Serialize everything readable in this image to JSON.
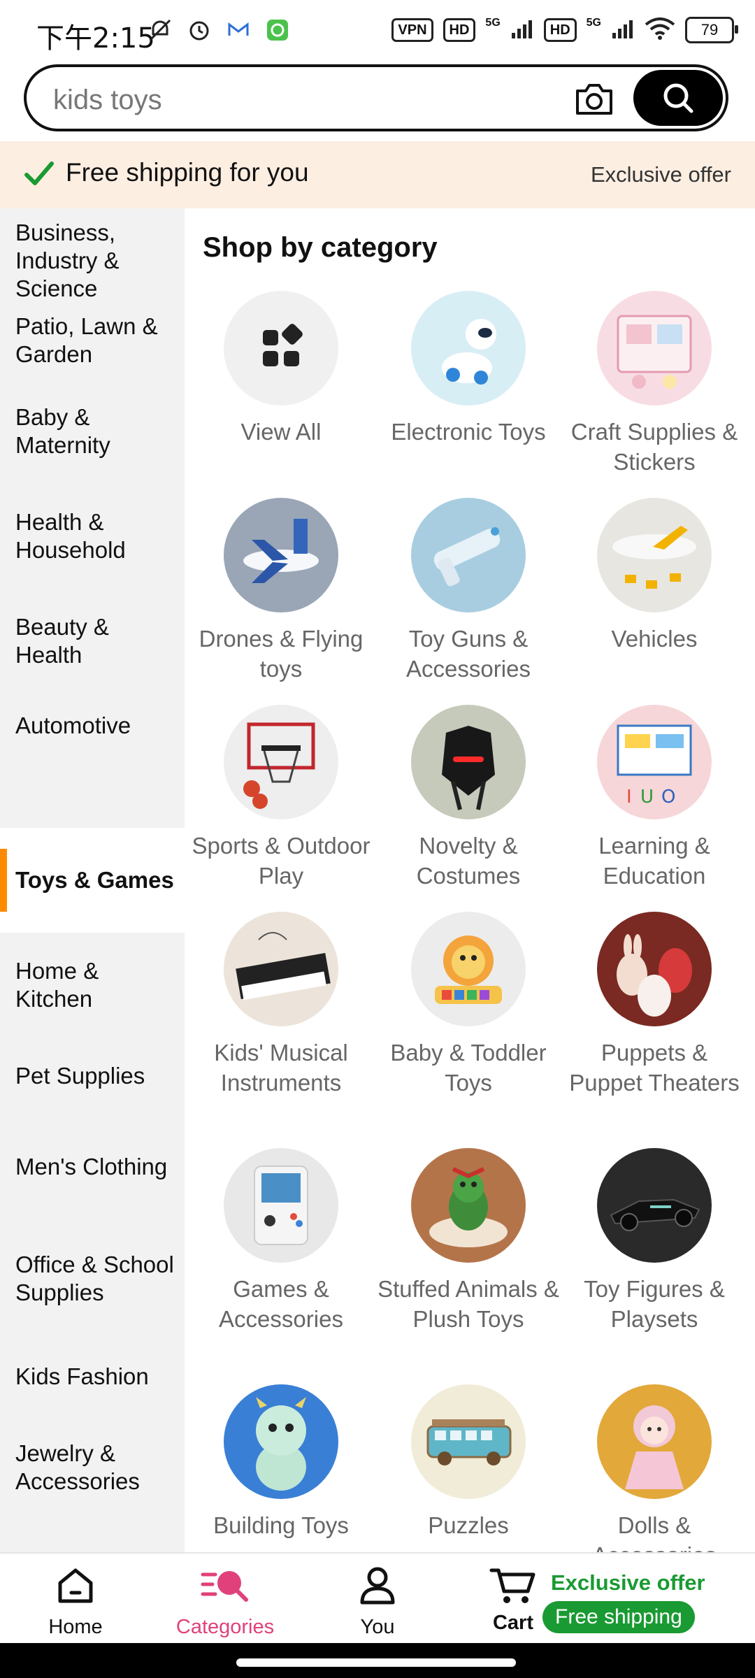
{
  "status": {
    "time": "下午2:15",
    "vpn": "VPN",
    "hd1": "HD",
    "net1": "5G",
    "hd2": "HD",
    "net2": "5G",
    "battery": "79"
  },
  "search": {
    "value": "kids toys",
    "placeholder": "kids toys"
  },
  "banner": {
    "shipping": "Free shipping for you",
    "offer": "Exclusive offer"
  },
  "sidebar": {
    "items": [
      {
        "label": "Business, Industry & Science"
      },
      {
        "label": "Patio, Lawn & Garden"
      },
      {
        "label": "Baby & Maternity"
      },
      {
        "label": "Health & Household"
      },
      {
        "label": "Beauty & Health"
      },
      {
        "label": "Automotive"
      },
      {
        "label": "Toys & Games",
        "active": true
      },
      {
        "label": "Home & Kitchen"
      },
      {
        "label": "Pet Supplies"
      },
      {
        "label": "Men's Clothing"
      },
      {
        "label": "Office & School Supplies"
      },
      {
        "label": "Kids Fashion"
      },
      {
        "label": "Jewelry & Accessories"
      }
    ]
  },
  "main": {
    "title": "Shop by category",
    "categories": [
      {
        "label": "View All",
        "icon": "grid-icon"
      },
      {
        "label": "Electronic Toys",
        "icon": "robot-dog-icon"
      },
      {
        "label": "Craft Supplies & Stickers",
        "icon": "sticker-book-icon"
      },
      {
        "label": "Drones & Flying toys",
        "icon": "airplane-icon"
      },
      {
        "label": "Toy Guns & Accessories",
        "icon": "water-gun-icon"
      },
      {
        "label": "Vehicles",
        "icon": "toy-plane-icon"
      },
      {
        "label": "Sports & Outdoor Play",
        "icon": "basketball-hoop-icon"
      },
      {
        "label": "Novelty & Costumes",
        "icon": "mask-icon"
      },
      {
        "label": "Learning & Education",
        "icon": "learning-board-icon"
      },
      {
        "label": "Kids' Musical Instruments",
        "icon": "keyboard-icon"
      },
      {
        "label": "Baby & Toddler Toys",
        "icon": "lion-piano-icon"
      },
      {
        "label": "Puppets & Puppet Theaters",
        "icon": "puppets-icon"
      },
      {
        "label": "Games & Accessories",
        "icon": "handheld-console-icon"
      },
      {
        "label": "Stuffed Animals & Plush Toys",
        "icon": "plush-dragon-icon"
      },
      {
        "label": "Toy Figures & Playsets",
        "icon": "race-car-icon"
      },
      {
        "label": "Building Toys",
        "icon": "blocks-figure-icon"
      },
      {
        "label": "Puzzles",
        "icon": "puzzle-bus-icon"
      },
      {
        "label": "Dolls & Accessories",
        "icon": "doll-icon"
      }
    ]
  },
  "nav": {
    "home": "Home",
    "categories": "Categories",
    "you": "You",
    "cart": "Cart",
    "offer": "Exclusive offer",
    "free": "Free shipping"
  },
  "colors": {
    "accent": "#ff8a00",
    "nav_active": "#e0417a",
    "green": "#1a9a32",
    "banner_bg": "#fdeee2"
  }
}
